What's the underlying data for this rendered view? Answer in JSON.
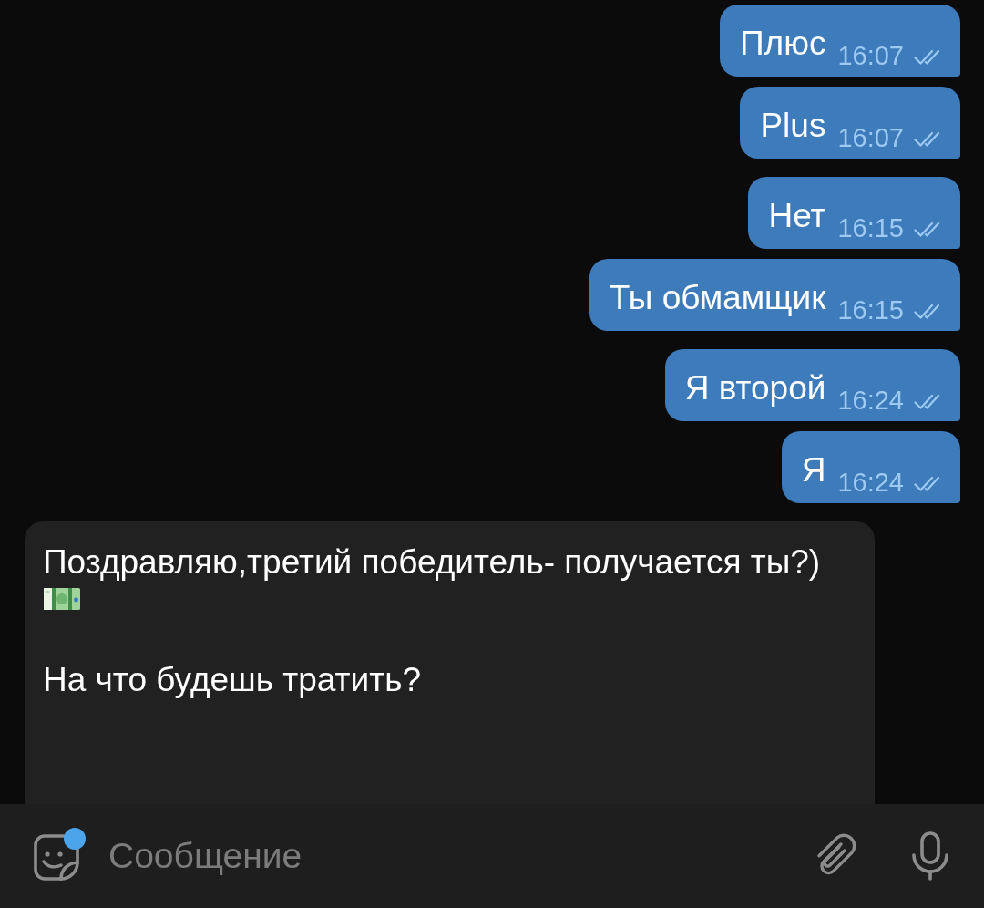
{
  "messages": [
    {
      "kind": "outgoing",
      "text": "Плюс",
      "time": "16:07",
      "read": true
    },
    {
      "kind": "outgoing",
      "text": "Plus",
      "time": "16:07",
      "read": true
    },
    {
      "kind": "outgoing",
      "text": "Нет",
      "time": "16:15",
      "read": true
    },
    {
      "kind": "outgoing",
      "text": "Ты обмамщик",
      "time": "16:15",
      "read": true
    },
    {
      "kind": "outgoing",
      "text": "Я второй",
      "time": "16:24",
      "read": true
    },
    {
      "kind": "outgoing",
      "text": "Я",
      "time": "16:24",
      "read": true
    },
    {
      "kind": "incoming",
      "parts": [
        {
          "kind": "text",
          "text": "Поздравляю,третий победитель- получается ты?)"
        },
        {
          "kind": "emoji"
        },
        {
          "kind": "text",
          "text": "На что будешь тратить?"
        }
      ]
    }
  ],
  "composer": {
    "placeholder": "Сообщение",
    "sticker_badge": true
  }
}
